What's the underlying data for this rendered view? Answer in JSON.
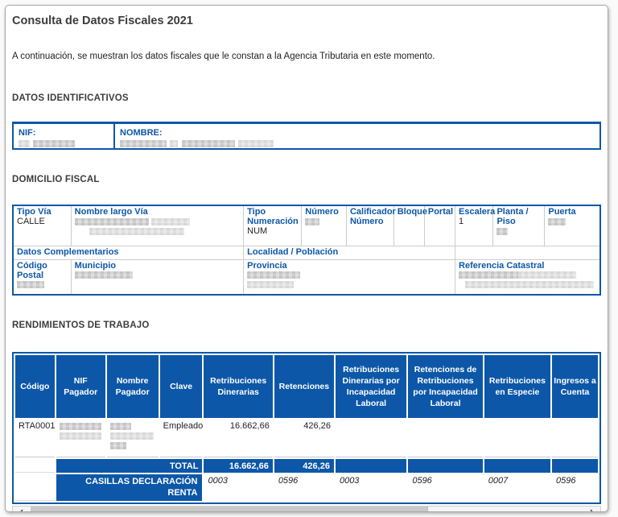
{
  "window": {
    "title": "Consulta de Datos Fiscales 2021",
    "intro": "A continuación, se muestran los datos fiscales que le constan a la Agencia Tributaria en este momento."
  },
  "colors": {
    "accent_blue": "#0d57a8",
    "heading_gray": "#3c3c3c"
  },
  "datos_identificativos": {
    "heading": "DATOS IDENTIFICATIVOS",
    "nif_label": "NIF:",
    "nombre_label": "NOMBRE:"
  },
  "domicilio_fiscal": {
    "heading": "DOMICILIO FISCAL",
    "labels": {
      "tipo_via": "Tipo Vía",
      "nombre_largo_via": "Nombre largo Vía",
      "tipo_numeracion": "Tipo Numeración",
      "numero": "Número",
      "calificador_numero": "Calificador Número",
      "bloque": "Bloque",
      "portal": "Portal",
      "escalera": "Escalera",
      "planta_piso": "Planta / Piso",
      "puerta": "Puerta",
      "datos_complementarios": "Datos Complementarios",
      "localidad_poblacion": "Localidad / Población",
      "codigo_postal": "Código Postal",
      "municipio": "Municipio",
      "provincia": "Provincia",
      "referencia_catastral": "Referencia Catastral"
    },
    "values": {
      "tipo_via": "CALLE",
      "tipo_numeracion": "NUM",
      "escalera": "1"
    }
  },
  "rendimientos_trabajo": {
    "heading": "RENDIMIENTOS DE TRABAJO",
    "columns": [
      "Código",
      "NIF Pagador",
      "Nombre Pagador",
      "Clave",
      "Retribuciones Dinerarias",
      "Retenciones",
      "Retribuciones Dinerarias por Incapacidad Laboral",
      "Retenciones de Retribuciones por Incapacidad Laboral",
      "Retribuciones en Especie",
      "Ingresos a Cuenta"
    ],
    "row": {
      "codigo": "RTA0001",
      "clave": "Empleado",
      "retribuciones_dinerarias": "16.662,66",
      "retenciones": "426,26"
    },
    "total_label": "TOTAL",
    "total": {
      "retribuciones_dinerarias": "16.662,66",
      "retenciones": "426,26"
    },
    "casillas_label": "CASILLAS DECLARACIÓN RENTA",
    "casillas": [
      "0003",
      "0596",
      "0003",
      "0596",
      "0007",
      "0596"
    ]
  },
  "scrollbar": {
    "left_arrow": "‹",
    "right_arrow": "›"
  }
}
